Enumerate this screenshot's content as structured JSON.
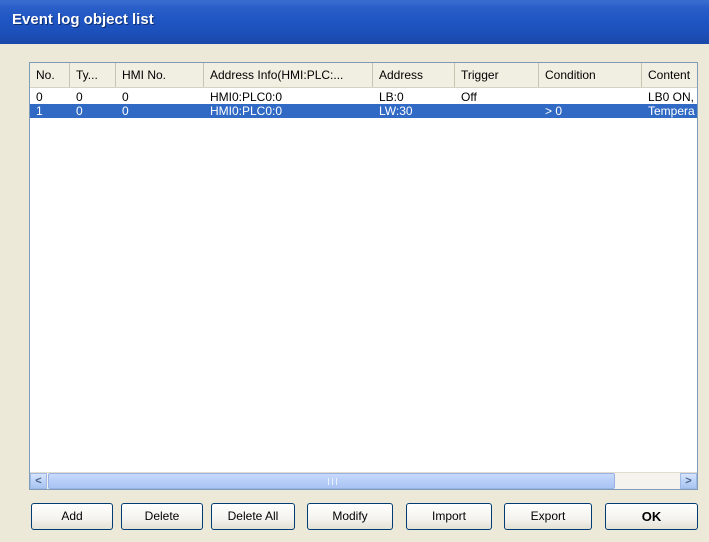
{
  "window": {
    "title": "Event log object list"
  },
  "list": {
    "columns": [
      "No.",
      "Ty...",
      "HMI No.",
      "Address Info(HMI:PLC:...",
      "Address",
      "Trigger",
      "Condition",
      "Content"
    ],
    "rows": [
      {
        "no": "0",
        "type": "0",
        "hmi_no": "0",
        "address_info": "HMI0:PLC0:0",
        "address": "LB:0",
        "trigger": "Off",
        "condition": "",
        "content": "LB0 ON,",
        "selected": false
      },
      {
        "no": "1",
        "type": "0",
        "hmi_no": "0",
        "address_info": "HMI0:PLC0:0",
        "address": "LW:30",
        "trigger": "",
        "condition": "> 0",
        "content": "Tempera",
        "selected": true
      }
    ],
    "selection_color": "#316ac5"
  },
  "scrollbar": {
    "left_icon": "chevron-left-icon",
    "right_icon": "chevron-right-icon",
    "left_glyph": "<",
    "right_glyph": ">"
  },
  "buttons": {
    "add": "Add",
    "delete": "Delete",
    "delete_all": "Delete All",
    "modify": "Modify",
    "import": "Import",
    "export": "Export",
    "ok": "OK"
  }
}
